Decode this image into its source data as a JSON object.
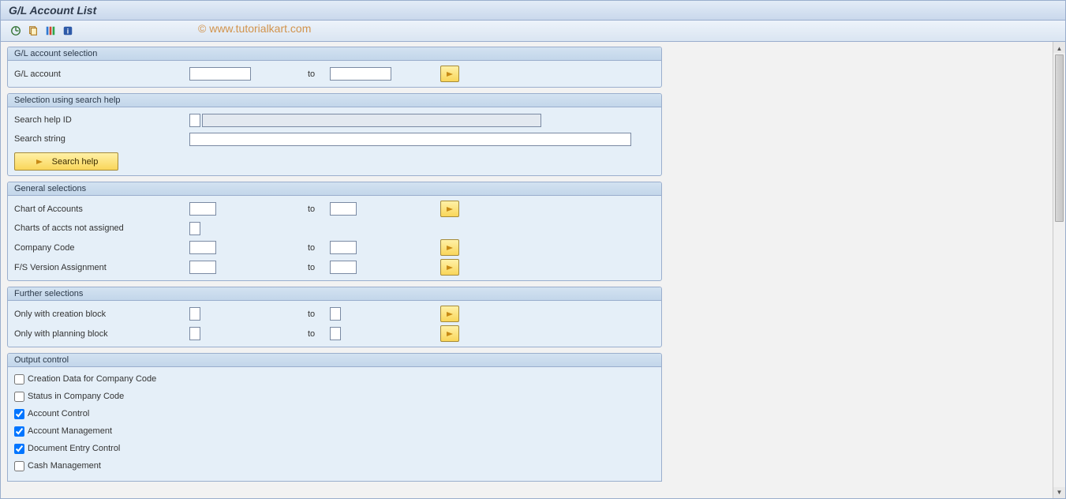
{
  "title": "G/L Account List",
  "watermark": "© www.tutorialkart.com",
  "toolbar": {
    "icons": [
      "execute-icon",
      "variant-icon",
      "color-bars-icon",
      "info-icon"
    ]
  },
  "groups": {
    "gl_sel": {
      "title": "G/L account selection",
      "gl_account_label": "G/L account",
      "to_label": "to"
    },
    "search": {
      "title": "Selection using search help",
      "help_id_label": "Search help ID",
      "string_label": "Search string",
      "button_label": "Search help"
    },
    "general": {
      "title": "General selections",
      "coa_label": "Chart of Accounts",
      "coa_na_label": "Charts of accts not assigned",
      "cc_label": "Company Code",
      "fsv_label": "F/S Version Assignment",
      "to_label": "to"
    },
    "further": {
      "title": "Further selections",
      "creation_label": "Only with creation block",
      "planning_label": "Only with planning block",
      "to_label": "to"
    },
    "output": {
      "title": "Output control",
      "items": [
        {
          "label": "Creation Data for Company Code",
          "checked": false
        },
        {
          "label": "Status in Company Code",
          "checked": false
        },
        {
          "label": "Account Control",
          "checked": true
        },
        {
          "label": "Account Management",
          "checked": true
        },
        {
          "label": "Document Entry Control",
          "checked": true
        },
        {
          "label": "Cash Management",
          "checked": false
        }
      ]
    }
  }
}
